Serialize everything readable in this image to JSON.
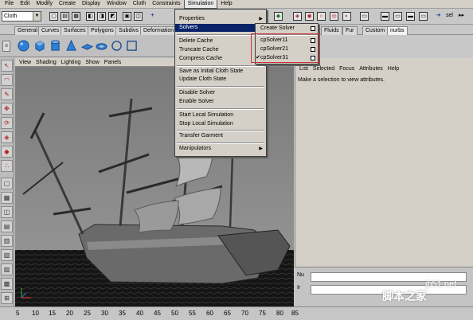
{
  "menubar": [
    "File",
    "Edit",
    "Modify",
    "Create",
    "Display",
    "Window",
    "Cloth",
    "Constraints",
    "Simulation",
    "Help"
  ],
  "mode_select": "Cloth",
  "toolbar_right": "sel",
  "shelf_tabs": [
    "General",
    "Curves",
    "Surfaces",
    "Polygons",
    "Subdivs",
    "Deformation",
    "Fluids",
    "Fur",
    "Custom",
    "nurbs"
  ],
  "viewport_menu": [
    "View",
    "Shading",
    "Lighting",
    "Show",
    "Panels"
  ],
  "attr_menu": [
    "List",
    "Selected",
    "Focus",
    "Attributes",
    "Help"
  ],
  "attr_message": "Make a selection to view attributes.",
  "simulation_menu": {
    "group1": [
      "Properties",
      "Solvers"
    ],
    "group2": [
      "Delete Cache",
      "Truncate Cache",
      "Compress Cache"
    ],
    "group3": [
      "Save as Initial Cloth State",
      "Update Cloth State"
    ],
    "group4": [
      "Disable Solver",
      "Enable Solver"
    ],
    "group5": [
      "Start Local Simulation",
      "Stop Local Simulation"
    ],
    "group6": [
      "Transfer Garment"
    ],
    "group7": [
      "Manipulators"
    ]
  },
  "solvers_menu": {
    "create": "Create Solver",
    "solvers": [
      "cpSolver11",
      "cpSolver21",
      "cpSolver31"
    ],
    "checked_index": 2
  },
  "lower_right": {
    "label1": "Nu",
    "label2": "Ir"
  },
  "timeline": [
    "5",
    "10",
    "15",
    "20",
    "25",
    "30",
    "35",
    "40",
    "45",
    "50",
    "55",
    "60",
    "65",
    "70",
    "75",
    "80",
    "85"
  ],
  "watermark": {
    "site": "jb51.net",
    "text": "脚本之家"
  },
  "colors": {
    "menu_bg": "#d4d0c8",
    "highlight": "#0a246a",
    "viewport": "#8a8a8a",
    "callout": "#d03030"
  }
}
